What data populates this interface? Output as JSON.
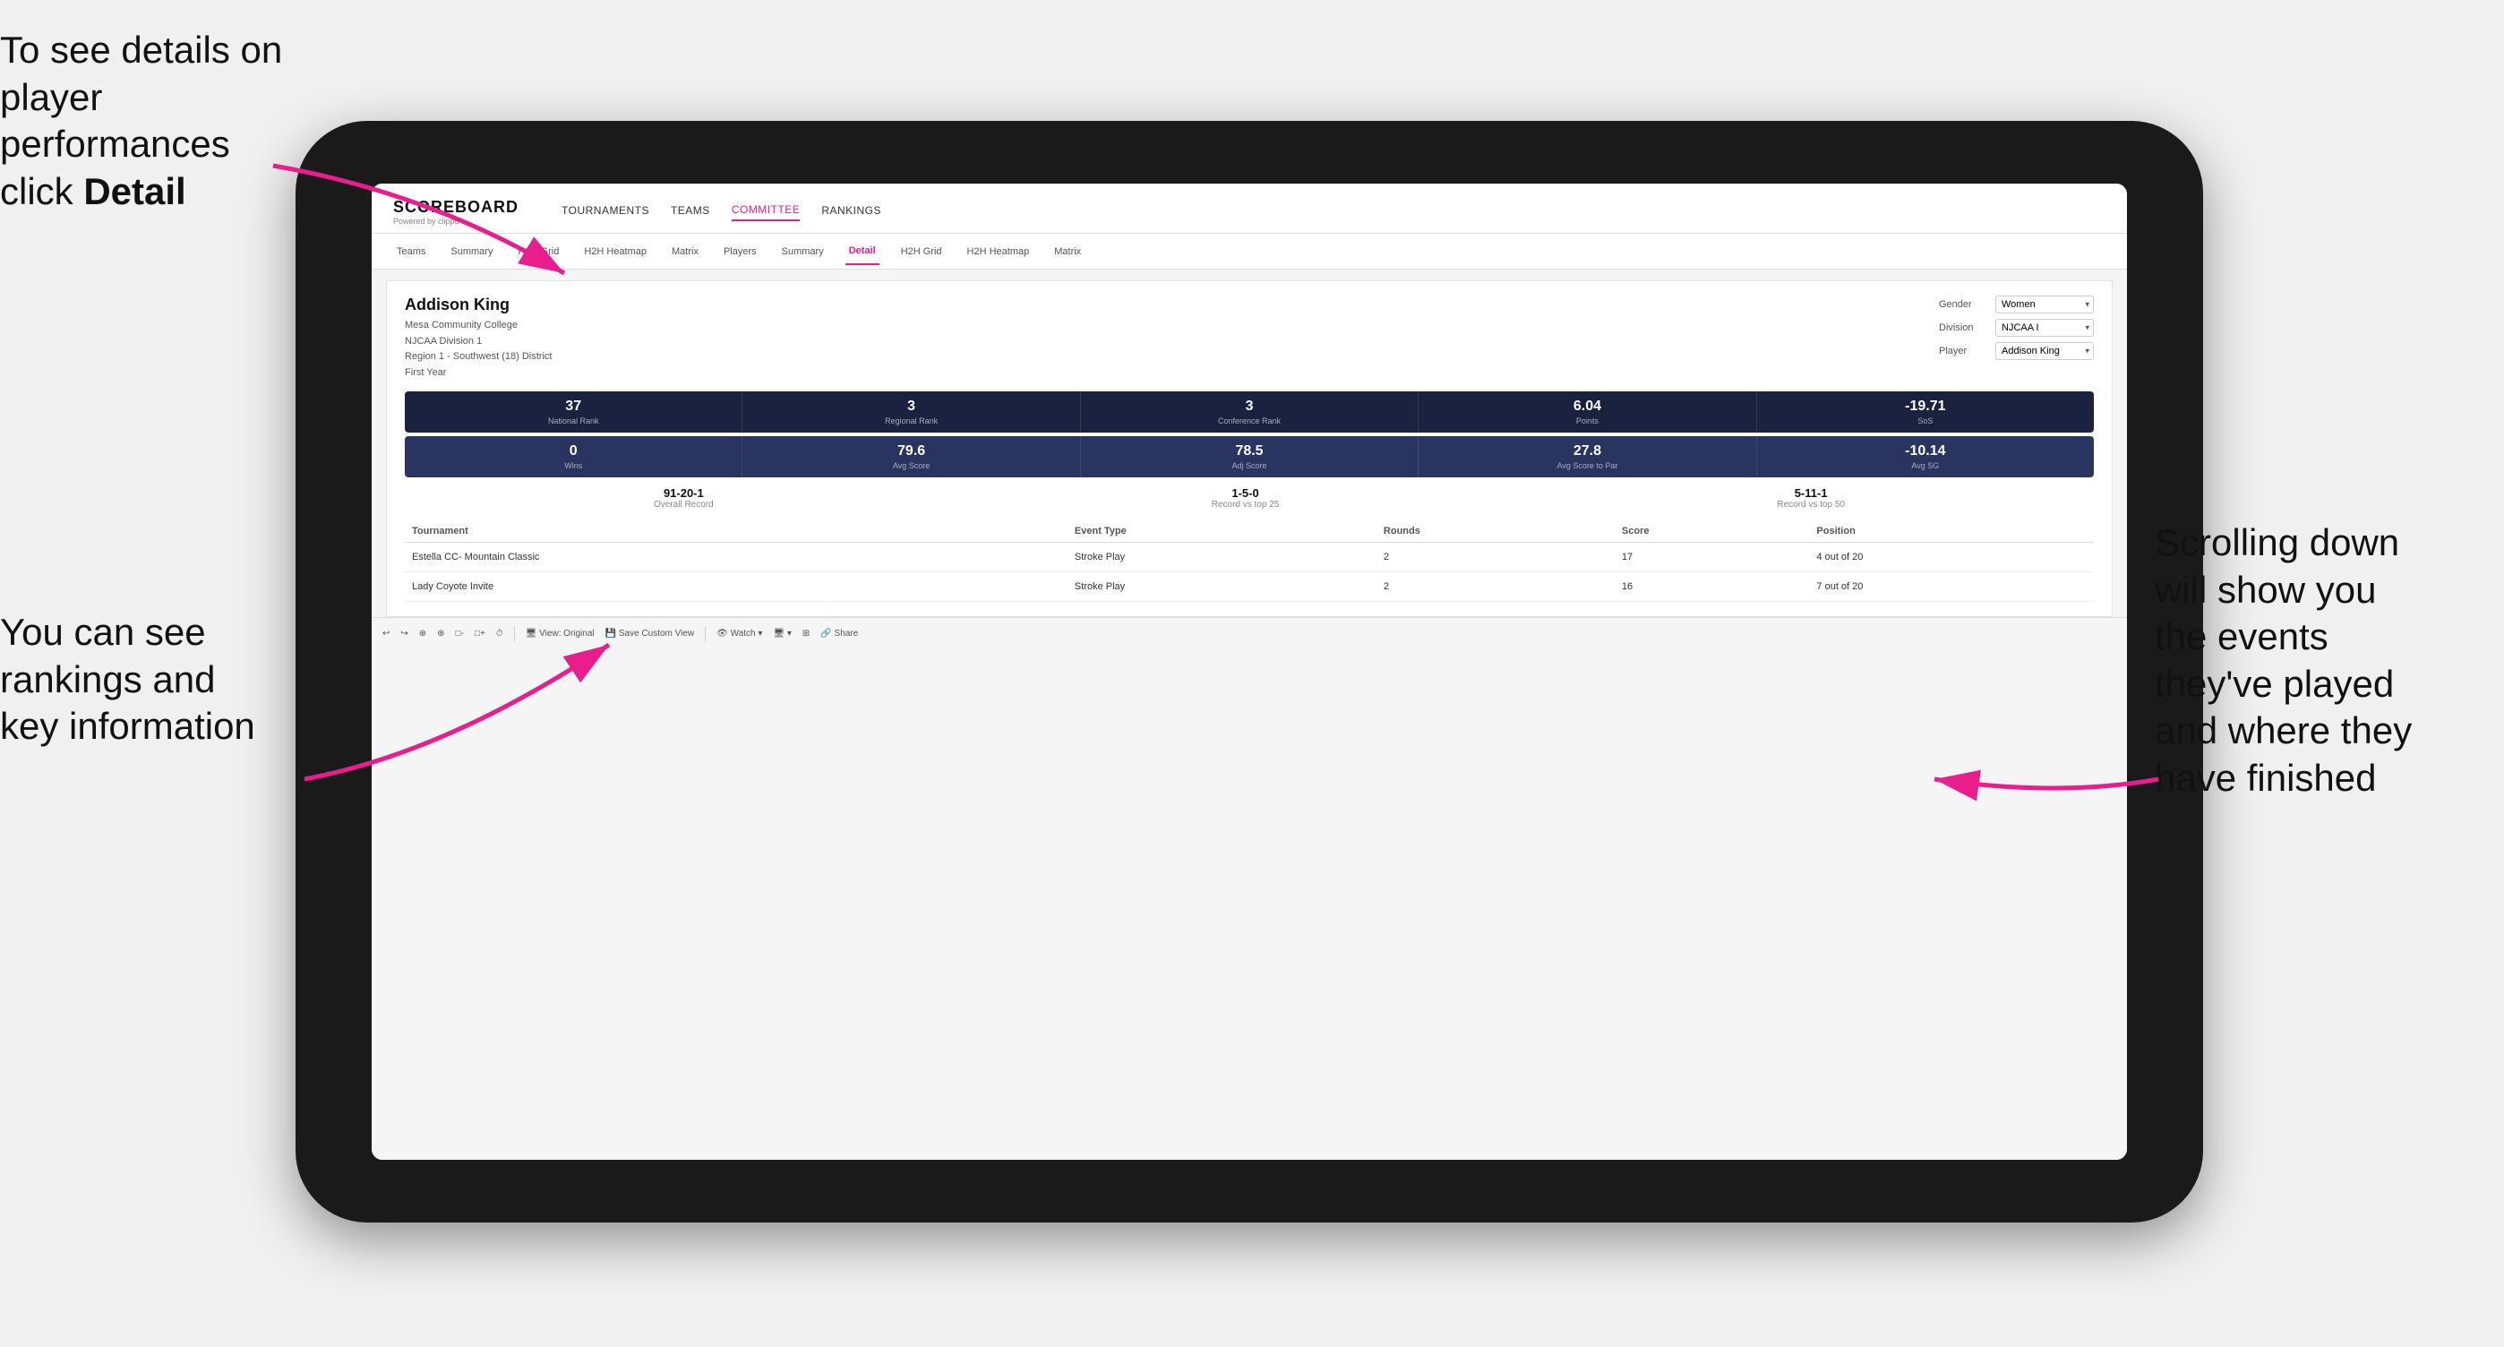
{
  "annotations": {
    "top_left_line1": "To see details on",
    "top_left_line2": "player performances",
    "top_left_line3": "click ",
    "top_left_bold": "Detail",
    "bottom_left_line1": "You can see",
    "bottom_left_line2": "rankings and",
    "bottom_left_line3": "key information",
    "right_line1": "Scrolling down",
    "right_line2": "will show you",
    "right_line3": "the events",
    "right_line4": "they've played",
    "right_line5": "and where they",
    "right_line6": "have finished"
  },
  "nav": {
    "logo": "SCOREBOARD",
    "logo_sub": "Powered by clippd",
    "items": [
      "TOURNAMENTS",
      "TEAMS",
      "COMMITTEE",
      "RANKINGS"
    ]
  },
  "subnav": {
    "items": [
      "Teams",
      "Summary",
      "H2H Grid",
      "H2H Heatmap",
      "Matrix",
      "Players",
      "Summary",
      "Detail",
      "H2H Grid",
      "H2H Heatmap",
      "Matrix"
    ]
  },
  "player": {
    "name": "Addison King",
    "school": "Mesa Community College",
    "division": "NJCAA Division 1",
    "region": "Region 1 - Southwest (18) District",
    "year": "First Year",
    "gender_label": "Gender",
    "gender_value": "Women",
    "division_label": "Division",
    "division_value": "NJCAA I",
    "player_label": "Player",
    "player_value": "Addison King"
  },
  "stats_row1": [
    {
      "value": "37",
      "label": "National Rank"
    },
    {
      "value": "3",
      "label": "Regional Rank"
    },
    {
      "value": "3",
      "label": "Conference Rank"
    },
    {
      "value": "6.04",
      "label": "Points"
    },
    {
      "value": "-19.71",
      "label": "SoS"
    }
  ],
  "stats_row2": [
    {
      "value": "0",
      "label": "Wins"
    },
    {
      "value": "79.6",
      "label": "Avg Score"
    },
    {
      "value": "78.5",
      "label": "Adj Score"
    },
    {
      "value": "27.8",
      "label": "Avg Score to Par"
    },
    {
      "value": "-10.14",
      "label": "Avg SG"
    }
  ],
  "records": [
    {
      "value": "91-20-1",
      "label": "Overall Record"
    },
    {
      "value": "1-5-0",
      "label": "Record vs top 25"
    },
    {
      "value": "5-11-1",
      "label": "Record vs top 50"
    }
  ],
  "table": {
    "headers": [
      "Tournament",
      "Event Type",
      "Rounds",
      "Score",
      "Position"
    ],
    "rows": [
      {
        "tournament": "Estella CC- Mountain Classic",
        "event_type": "Stroke Play",
        "rounds": "2",
        "score": "17",
        "position": "4 out of 20"
      },
      {
        "tournament": "Lady Coyote Invite",
        "event_type": "Stroke Play",
        "rounds": "2",
        "score": "16",
        "position": "7 out of 20"
      }
    ]
  },
  "toolbar": {
    "items": [
      "↩",
      "↪",
      "⊕",
      "⊕",
      "□-",
      "□+",
      "⏱",
      "View: Original",
      "Save Custom View",
      "Watch ▾",
      "🖥 ▾",
      "⊞",
      "Share"
    ]
  }
}
